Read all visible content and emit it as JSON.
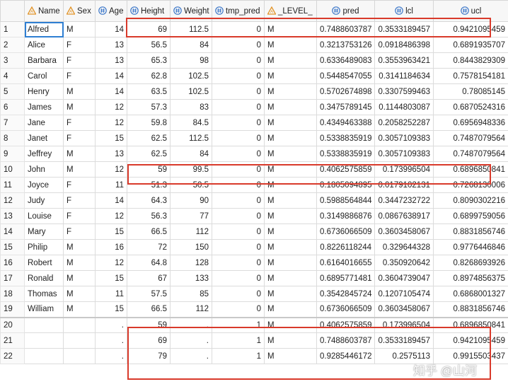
{
  "columns": [
    {
      "key": "name",
      "label": "Name",
      "type": "char"
    },
    {
      "key": "sex",
      "label": "Sex",
      "type": "char"
    },
    {
      "key": "age",
      "label": "Age",
      "type": "num"
    },
    {
      "key": "height",
      "label": "Height",
      "type": "num"
    },
    {
      "key": "weight",
      "label": "Weight",
      "type": "num"
    },
    {
      "key": "tmp_pred",
      "label": "tmp_pred",
      "type": "num"
    },
    {
      "key": "level",
      "label": "_LEVEL_",
      "type": "char"
    },
    {
      "key": "pred",
      "label": "pred",
      "type": "num"
    },
    {
      "key": "lcl",
      "label": "lcl",
      "type": "num"
    },
    {
      "key": "ucl",
      "label": "ucl",
      "type": "num"
    }
  ],
  "rows": [
    {
      "n": "1",
      "name": "Alfred",
      "sex": "M",
      "age": "14",
      "height": "69",
      "weight": "112.5",
      "tmp_pred": "0",
      "level": "M",
      "pred": "0.7488603787",
      "lcl": "0.3533189457",
      "ucl": "0.9421095459"
    },
    {
      "n": "2",
      "name": "Alice",
      "sex": "F",
      "age": "13",
      "height": "56.5",
      "weight": "84",
      "tmp_pred": "0",
      "level": "M",
      "pred": "0.3213753126",
      "lcl": "0.0918486398",
      "ucl": "0.6891935707"
    },
    {
      "n": "3",
      "name": "Barbara",
      "sex": "F",
      "age": "13",
      "height": "65.3",
      "weight": "98",
      "tmp_pred": "0",
      "level": "M",
      "pred": "0.6336489083",
      "lcl": "0.3553963421",
      "ucl": "0.8443829309"
    },
    {
      "n": "4",
      "name": "Carol",
      "sex": "F",
      "age": "14",
      "height": "62.8",
      "weight": "102.5",
      "tmp_pred": "0",
      "level": "M",
      "pred": "0.5448547055",
      "lcl": "0.3141184634",
      "ucl": "0.7578154181"
    },
    {
      "n": "5",
      "name": "Henry",
      "sex": "M",
      "age": "14",
      "height": "63.5",
      "weight": "102.5",
      "tmp_pred": "0",
      "level": "M",
      "pred": "0.5702674898",
      "lcl": "0.3307599463",
      "ucl": "0.78085145"
    },
    {
      "n": "6",
      "name": "James",
      "sex": "M",
      "age": "12",
      "height": "57.3",
      "weight": "83",
      "tmp_pred": "0",
      "level": "M",
      "pred": "0.3475789145",
      "lcl": "0.1144803087",
      "ucl": "0.6870524316"
    },
    {
      "n": "7",
      "name": "Jane",
      "sex": "F",
      "age": "12",
      "height": "59.8",
      "weight": "84.5",
      "tmp_pred": "0",
      "level": "M",
      "pred": "0.4349463388",
      "lcl": "0.2058252287",
      "ucl": "0.6956948336"
    },
    {
      "n": "8",
      "name": "Janet",
      "sex": "F",
      "age": "15",
      "height": "62.5",
      "weight": "112.5",
      "tmp_pred": "0",
      "level": "M",
      "pred": "0.5338835919",
      "lcl": "0.3057109383",
      "ucl": "0.7487079564"
    },
    {
      "n": "9",
      "name": "Jeffrey",
      "sex": "M",
      "age": "13",
      "height": "62.5",
      "weight": "84",
      "tmp_pred": "0",
      "level": "M",
      "pred": "0.5338835919",
      "lcl": "0.3057109383",
      "ucl": "0.7487079564"
    },
    {
      "n": "10",
      "name": "John",
      "sex": "M",
      "age": "12",
      "height": "59",
      "weight": "99.5",
      "tmp_pred": "0",
      "level": "M",
      "pred": "0.4062575859",
      "lcl": "0.173996504",
      "ucl": "0.6896850841"
    },
    {
      "n": "11",
      "name": "Joyce",
      "sex": "F",
      "age": "11",
      "height": "51.3",
      "weight": "50.5",
      "tmp_pred": "0",
      "level": "M",
      "pred": "0.1805094895",
      "lcl": "0.0179102131",
      "ucl": "0.7268130006"
    },
    {
      "n": "12",
      "name": "Judy",
      "sex": "F",
      "age": "14",
      "height": "64.3",
      "weight": "90",
      "tmp_pred": "0",
      "level": "M",
      "pred": "0.5988564844",
      "lcl": "0.3447232722",
      "ucl": "0.8090302216"
    },
    {
      "n": "13",
      "name": "Louise",
      "sex": "F",
      "age": "12",
      "height": "56.3",
      "weight": "77",
      "tmp_pred": "0",
      "level": "M",
      "pred": "0.3149886876",
      "lcl": "0.0867638917",
      "ucl": "0.6899759056"
    },
    {
      "n": "14",
      "name": "Mary",
      "sex": "F",
      "age": "15",
      "height": "66.5",
      "weight": "112",
      "tmp_pred": "0",
      "level": "M",
      "pred": "0.6736066509",
      "lcl": "0.3603458067",
      "ucl": "0.8831856746"
    },
    {
      "n": "15",
      "name": "Philip",
      "sex": "M",
      "age": "16",
      "height": "72",
      "weight": "150",
      "tmp_pred": "0",
      "level": "M",
      "pred": "0.8226118244",
      "lcl": "0.329644328",
      "ucl": "0.9776446846"
    },
    {
      "n": "16",
      "name": "Robert",
      "sex": "M",
      "age": "12",
      "height": "64.8",
      "weight": "128",
      "tmp_pred": "0",
      "level": "M",
      "pred": "0.6164016655",
      "lcl": "0.350920642",
      "ucl": "0.8268693926"
    },
    {
      "n": "17",
      "name": "Ronald",
      "sex": "M",
      "age": "15",
      "height": "67",
      "weight": "133",
      "tmp_pred": "0",
      "level": "M",
      "pred": "0.6895771481",
      "lcl": "0.3604739047",
      "ucl": "0.8974856375"
    },
    {
      "n": "18",
      "name": "Thomas",
      "sex": "M",
      "age": "11",
      "height": "57.5",
      "weight": "85",
      "tmp_pred": "0",
      "level": "M",
      "pred": "0.3542845724",
      "lcl": "0.1207105474",
      "ucl": "0.6868001327"
    },
    {
      "n": "19",
      "name": "William",
      "sex": "M",
      "age": "15",
      "height": "66.5",
      "weight": "112",
      "tmp_pred": "0",
      "level": "M",
      "pred": "0.6736066509",
      "lcl": "0.3603458067",
      "ucl": "0.8831856746"
    },
    {
      "n": "20",
      "name": "",
      "sex": "",
      "age": ".",
      "height": "59",
      "weight": ".",
      "tmp_pred": "1",
      "level": "M",
      "pred": "0.4062575859",
      "lcl": "0.173996504",
      "ucl": "0.6896850841"
    },
    {
      "n": "21",
      "name": "",
      "sex": "",
      "age": ".",
      "height": "69",
      "weight": ".",
      "tmp_pred": "1",
      "level": "M",
      "pred": "0.7488603787",
      "lcl": "0.3533189457",
      "ucl": "0.9421095459"
    },
    {
      "n": "22",
      "name": "",
      "sex": "",
      "age": ".",
      "height": "79",
      "weight": ".",
      "tmp_pred": "1",
      "level": "M",
      "pred": "0.9285446172",
      "lcl": "0.2575113",
      "ucl": "0.9915503437"
    }
  ],
  "watermark": "知乎 @山河",
  "icons": {
    "char": "char-type-icon",
    "num": "num-type-icon"
  },
  "colors": {
    "highlight_box": "#d93a2b",
    "char_icon": "#e2962c",
    "num_icon": "#3d78c9",
    "selection": "#2f7fd2"
  }
}
